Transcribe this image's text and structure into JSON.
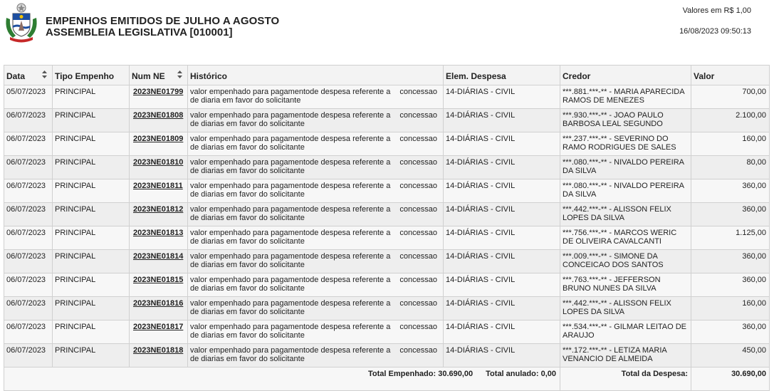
{
  "header": {
    "title_line1": "EMPENHOS EMITIDOS  DE JULHO A AGOSTO",
    "title_line2": "ASSEMBLEIA LEGISLATIVA [010001]",
    "currency_note": "Valores em R$ 1,00",
    "generated_at": "16/08/2023 09:50:13"
  },
  "colors": {
    "header_bg": "#f3f3f3",
    "row_odd": "#f7f7f7",
    "row_even": "#eeeeee",
    "border": "#d0d0d0"
  },
  "columns": [
    "Data",
    "Tipo Empenho",
    "Num NE",
    "Histórico",
    "Elem. Despesa",
    "Credor",
    "Valor"
  ],
  "rows": [
    {
      "data": "05/07/2023",
      "tipo": "PRINCIPAL",
      "num_ne": "2023NE01799",
      "hist_a": "valor empenhado para pagamentode despesa referente a",
      "hist_b": "concessao",
      "hist_c": "de diaria em favor  do solicitante",
      "elem": "14-DIÁRIAS - CIVIL",
      "credor": "***.881.***-** - MARIA APARECIDA RAMOS DE MENEZES",
      "valor": "700,00"
    },
    {
      "data": "06/07/2023",
      "tipo": "PRINCIPAL",
      "num_ne": "2023NE01808",
      "hist_a": "valor empenhado para pagamentode despesa referente a",
      "hist_b": "concessao",
      "hist_c": "de diarias em favor do solicitante",
      "elem": "14-DIÁRIAS - CIVIL",
      "credor": "***.930.***-** - JOAO PAULO BARBOSA LEAL SEGUNDO",
      "valor": "2.100,00"
    },
    {
      "data": "06/07/2023",
      "tipo": "PRINCIPAL",
      "num_ne": "2023NE01809",
      "hist_a": "valor empenhado para pagamentode despesa referente a",
      "hist_b": "concessao",
      "hist_c": "de diarias em favor do solicitante",
      "elem": "14-DIÁRIAS - CIVIL",
      "credor": "***.237.***-** - SEVERINO DO RAMO RODRIGUES DE SALES",
      "valor": "160,00"
    },
    {
      "data": "06/07/2023",
      "tipo": "PRINCIPAL",
      "num_ne": "2023NE01810",
      "hist_a": "valor empenhado para pagamentode despesa referente a",
      "hist_b": "concessao",
      "hist_c": "de diarias em favor do solicitante",
      "elem": "14-DIÁRIAS - CIVIL",
      "credor": "***.080.***-** - NIVALDO PEREIRA DA SILVA",
      "valor": "80,00"
    },
    {
      "data": "06/07/2023",
      "tipo": "PRINCIPAL",
      "num_ne": "2023NE01811",
      "hist_a": "valor empenhado para pagamentode despesa referente a",
      "hist_b": "concessao",
      "hist_c": "de diarias em favor do solicitante",
      "elem": "14-DIÁRIAS - CIVIL",
      "credor": "***.080.***-** - NIVALDO PEREIRA DA SILVA",
      "valor": "360,00"
    },
    {
      "data": "06/07/2023",
      "tipo": "PRINCIPAL",
      "num_ne": "2023NE01812",
      "hist_a": "valor empenhado para pagamentode despesa referente a",
      "hist_b": "concessao",
      "hist_c": "de diarias em favor do solicitante",
      "elem": "14-DIÁRIAS - CIVIL",
      "credor": "***.442.***-** - ALISSON FELIX LOPES DA SILVA",
      "valor": "360,00"
    },
    {
      "data": "06/07/2023",
      "tipo": "PRINCIPAL",
      "num_ne": "2023NE01813",
      "hist_a": "valor empenhado para pagamentode despesa referente a",
      "hist_b": "concessao",
      "hist_c": "de diarias em favor do solicitante",
      "elem": "14-DIÁRIAS - CIVIL",
      "credor": "***.756.***-** - MARCOS WERIC DE OLIVEIRA CAVALCANTI",
      "valor": "1.125,00"
    },
    {
      "data": "06/07/2023",
      "tipo": "PRINCIPAL",
      "num_ne": "2023NE01814",
      "hist_a": "valor empenhado para pagamentode despesa referente a",
      "hist_b": "concessao",
      "hist_c": "de diarias em favor do solicitante",
      "elem": "14-DIÁRIAS - CIVIL",
      "credor": "***.009.***-** - SIMONE DA CONCEICAO DOS SANTOS",
      "valor": "360,00"
    },
    {
      "data": "06/07/2023",
      "tipo": "PRINCIPAL",
      "num_ne": "2023NE01815",
      "hist_a": "valor empenhado para pagamentode despesa referente a",
      "hist_b": "concessao",
      "hist_c": "de diarias em favor do solicitante",
      "elem": "14-DIÁRIAS - CIVIL",
      "credor": "***.763.***-** - JEFFERSON BRUNO NUNES DA SILVA",
      "valor": "360,00"
    },
    {
      "data": "06/07/2023",
      "tipo": "PRINCIPAL",
      "num_ne": "2023NE01816",
      "hist_a": "valor empenhado para pagamentode despesa referente a",
      "hist_b": "concessao",
      "hist_c": "de diarias em favor do solicitante",
      "elem": "14-DIÁRIAS - CIVIL",
      "credor": "***.442.***-** - ALISSON FELIX LOPES DA SILVA",
      "valor": "160,00"
    },
    {
      "data": "06/07/2023",
      "tipo": "PRINCIPAL",
      "num_ne": "2023NE01817",
      "hist_a": "valor empenhado para pagamentode despesa referente a",
      "hist_b": "concessao",
      "hist_c": "de diarias em favor do solicitante",
      "elem": "14-DIÁRIAS - CIVIL",
      "credor": "***.534.***-** - GILMAR LEITAO DE ARAUJO",
      "valor": "360,00"
    },
    {
      "data": "06/07/2023",
      "tipo": "PRINCIPAL",
      "num_ne": "2023NE01818",
      "hist_a": "valor empenhado para pagamentode despesa referente a",
      "hist_b": "concessao",
      "hist_c": "de diarias em favor do solicitante",
      "elem": "14-DIÁRIAS - CIVIL",
      "credor": "***.172.***-** - LETIZA MARIA VENANCIO DE ALMEIDA",
      "valor": "450,00"
    }
  ],
  "totals": {
    "empenhado_label": "Total Empenhado:",
    "empenhado": "30.690,00",
    "anulado_label": "Total anulado:",
    "anulado": "0,00",
    "despesa_label": "Total da Despesa:",
    "despesa": "30.690,00"
  }
}
